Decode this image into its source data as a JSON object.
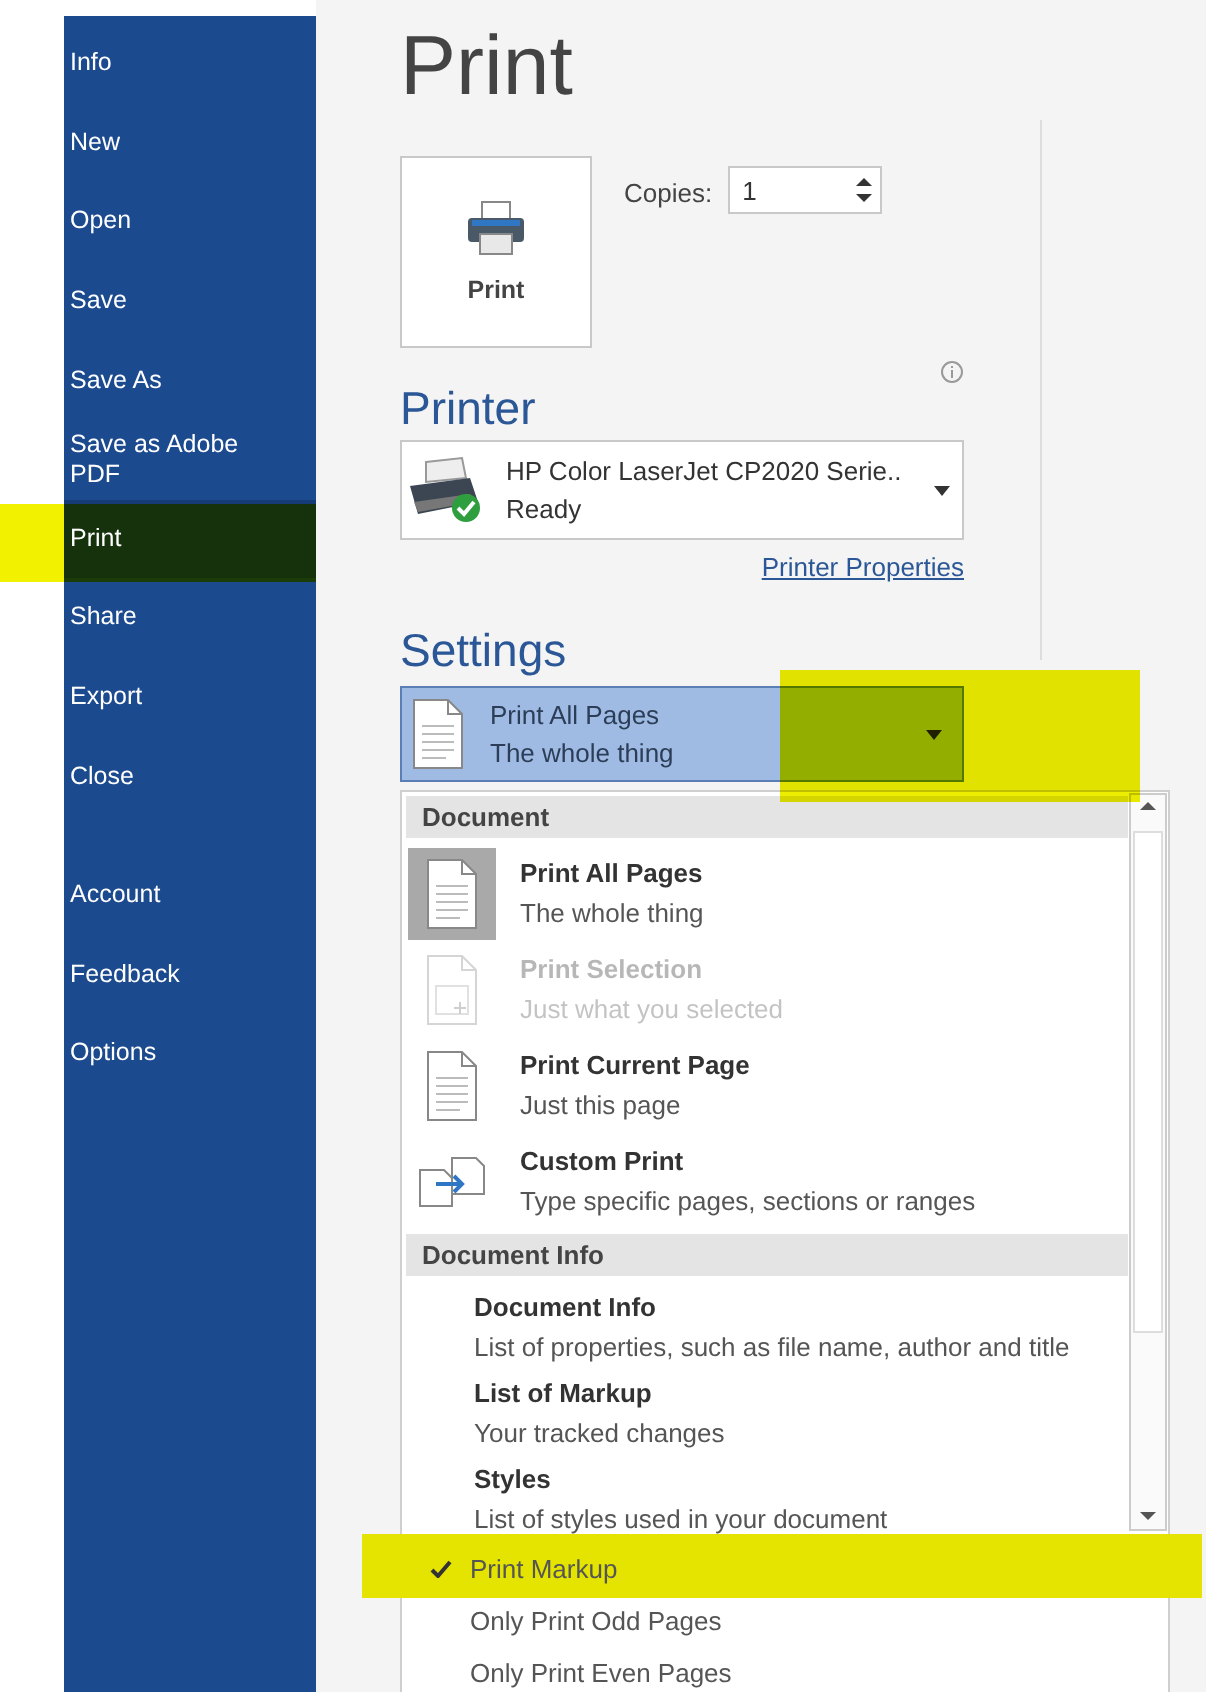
{
  "nav": {
    "items": [
      {
        "label": "Info",
        "selected": false,
        "highlighted": false
      },
      {
        "label": "New",
        "selected": false,
        "highlighted": false
      },
      {
        "label": "Open",
        "selected": false,
        "highlighted": false
      },
      {
        "label": "Save",
        "selected": false,
        "highlighted": false
      },
      {
        "label": "Save As",
        "selected": false,
        "highlighted": false
      },
      {
        "label": "Save as Adobe PDF",
        "selected": false,
        "highlighted": false
      },
      {
        "label": "Print",
        "selected": true,
        "highlighted": true
      },
      {
        "label": "Share",
        "selected": false,
        "highlighted": false
      },
      {
        "label": "Export",
        "selected": false,
        "highlighted": false
      },
      {
        "label": "Close",
        "selected": false,
        "highlighted": false
      }
    ],
    "bottom_items": [
      {
        "label": "Account",
        "selected": false,
        "highlighted": false
      },
      {
        "label": "Feedback",
        "selected": false,
        "highlighted": false
      },
      {
        "label": "Options",
        "selected": false,
        "highlighted": false
      }
    ]
  },
  "title": "Print",
  "print_button": {
    "label": "Print"
  },
  "copies": {
    "label": "Copies:",
    "value": "1"
  },
  "printer": {
    "heading": "Printer",
    "name": "HP Color LaserJet CP2020 Serie..",
    "status": "Ready",
    "properties_link": "Printer Properties"
  },
  "settings": {
    "heading": "Settings",
    "dropdown": {
      "title": "Print All Pages",
      "subtitle": "The whole thing",
      "highlighted": true
    },
    "list": [
      {
        "kind": "header",
        "label": "Document"
      },
      {
        "kind": "page-option",
        "title": "Print All Pages",
        "subtitle": "The whole thing",
        "selected": true,
        "disabled": false
      },
      {
        "kind": "selection-option",
        "title": "Print Selection",
        "subtitle": "Just what you selected",
        "selected": false,
        "disabled": true
      },
      {
        "kind": "page-option",
        "title": "Print Current Page",
        "subtitle": "Just this page",
        "selected": false,
        "disabled": false
      },
      {
        "kind": "custom-option",
        "title": "Custom Print",
        "subtitle": "Type specific pages, sections or ranges",
        "selected": false,
        "disabled": false
      },
      {
        "kind": "header",
        "label": "Document Info"
      },
      {
        "kind": "text-option",
        "title": "Document Info",
        "subtitle": "List of properties, such as file name, author and title",
        "selected": false,
        "disabled": false
      },
      {
        "kind": "text-option",
        "title": "List of Markup",
        "subtitle": "Your tracked changes",
        "selected": false,
        "disabled": false
      },
      {
        "kind": "text-option",
        "title": "Styles",
        "subtitle": "List of styles used in your document",
        "selected": false,
        "disabled": false
      }
    ],
    "toggles": [
      {
        "label": "Print Markup",
        "checked": true,
        "highlighted": true
      },
      {
        "label": "Only Print Odd Pages",
        "checked": false,
        "highlighted": false
      },
      {
        "label": "Only Print Even Pages",
        "checked": false,
        "highlighted": false
      }
    ]
  }
}
